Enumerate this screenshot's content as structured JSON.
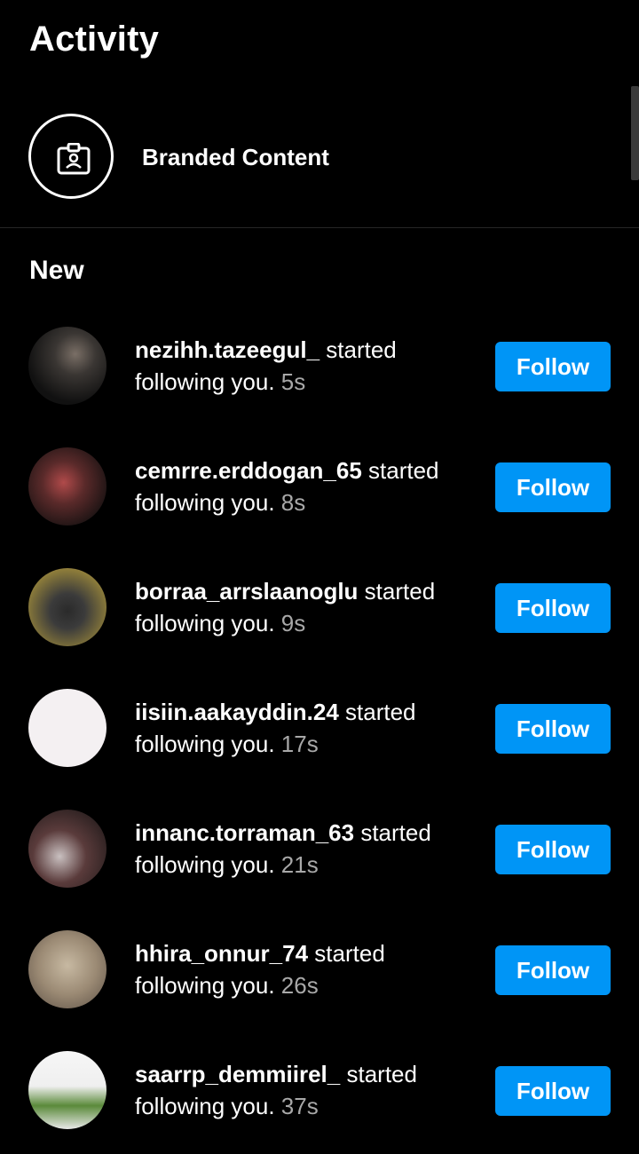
{
  "header": {
    "title": "Activity"
  },
  "branded": {
    "label": "Branded Content",
    "icon": "badge-icon"
  },
  "section": {
    "title": "New"
  },
  "notifications": [
    {
      "username": "nezihh.tazeegul_",
      "action": "started",
      "line2": "following you.",
      "time": "5s",
      "button": "Follow"
    },
    {
      "username": "cemrre.erddogan_65",
      "action": "started",
      "line2": "following you.",
      "time": "8s",
      "button": "Follow"
    },
    {
      "username": "borraa_arrslaanoglu",
      "action": "started",
      "line2": "following you.",
      "time": "9s",
      "button": "Follow"
    },
    {
      "username": "iisiin.aakayddin.24",
      "action": "started",
      "line2": "following you.",
      "time": "17s",
      "button": "Follow"
    },
    {
      "username": "innanc.torraman_63",
      "action": "started",
      "line2": "following you.",
      "time": "21s",
      "button": "Follow"
    },
    {
      "username": "hhira_onnur_74",
      "action": "started",
      "line2": "following you.",
      "time": "26s",
      "button": "Follow"
    },
    {
      "username": "saarrp_demmiirel_",
      "action": "started",
      "line2": "following you.",
      "time": "37s",
      "button": "Follow"
    }
  ],
  "colors": {
    "background": "#000000",
    "accent": "#0095f6",
    "secondary_text": "#a8a8a8"
  }
}
